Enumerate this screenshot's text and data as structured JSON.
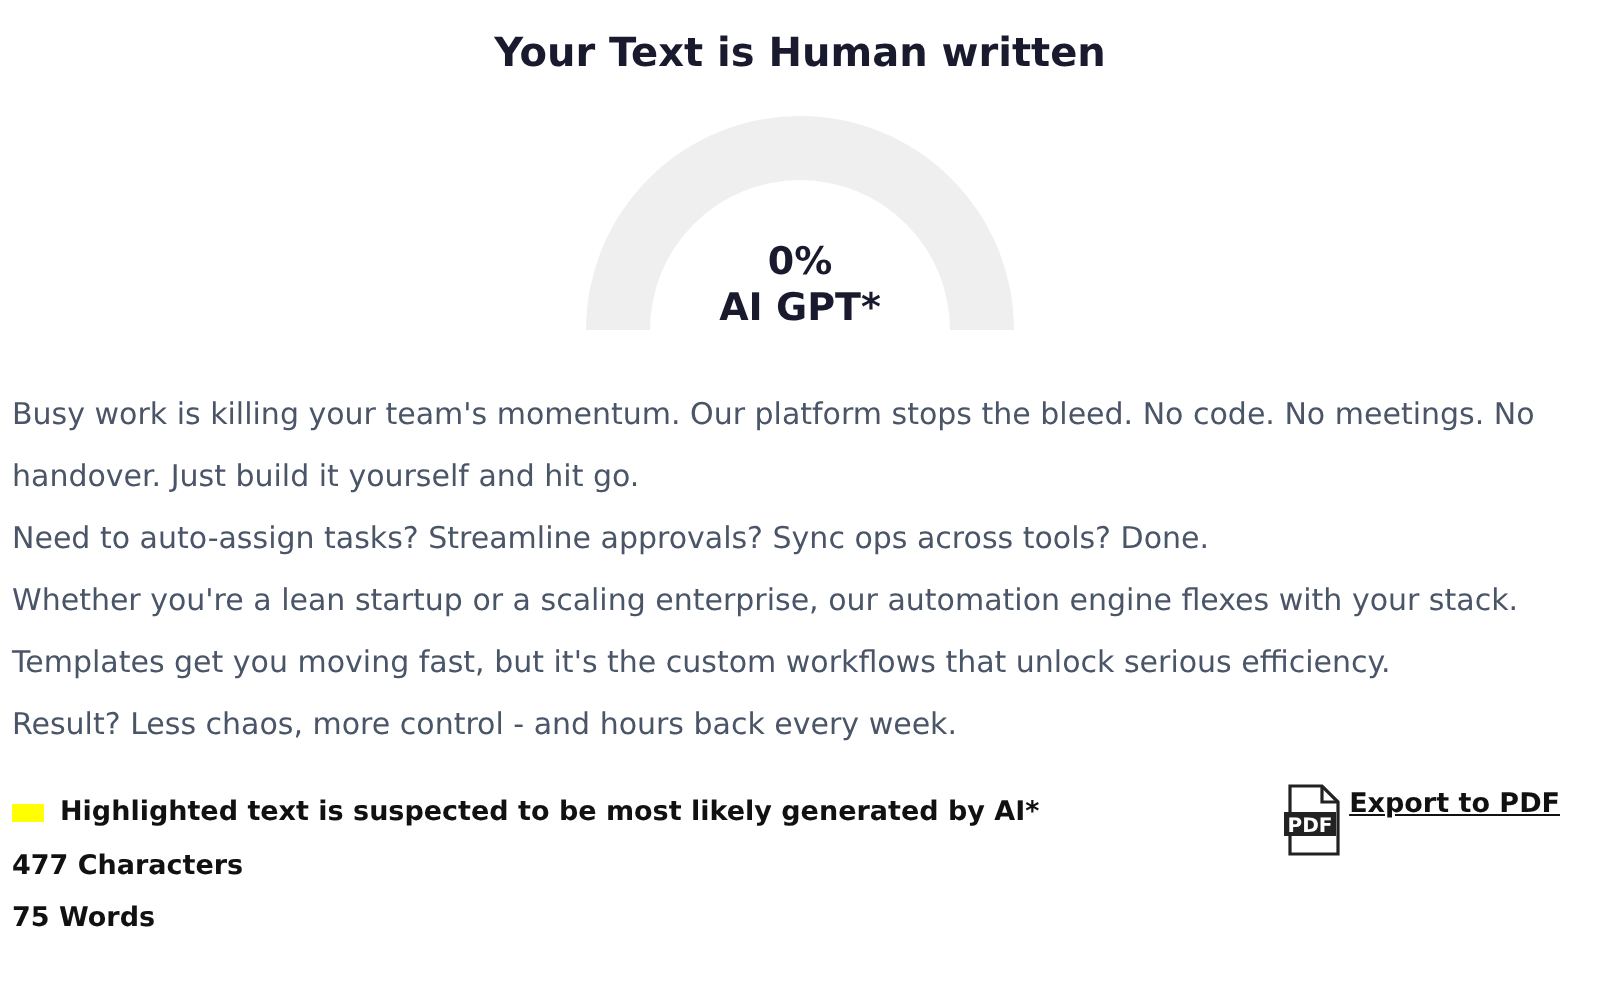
{
  "title": "Your Text is Human written",
  "gauge": {
    "percent": "0%",
    "label": "AI GPT*"
  },
  "paragraphs": [
    "Busy work is killing your team's momentum. Our platform stops the bleed. No code. No meetings. No handover. Just build it yourself and hit go.",
    "Need to auto-assign tasks? Streamline approvals? Sync ops across tools? Done.",
    "Whether you're a lean startup or a scaling enterprise, our automation engine flexes with your stack.",
    "Templates get you moving fast, but it's the custom workflows that unlock serious efficiency.",
    "Result? Less chaos, more control - and hours back every week."
  ],
  "legend": {
    "color": "#ffff00",
    "text": "Highlighted text is suspected to be most likely generated by AI*"
  },
  "stats": [
    "477 Characters",
    "75 Words"
  ],
  "export": {
    "icon_text": "PDF",
    "label": "Export to PDF"
  }
}
